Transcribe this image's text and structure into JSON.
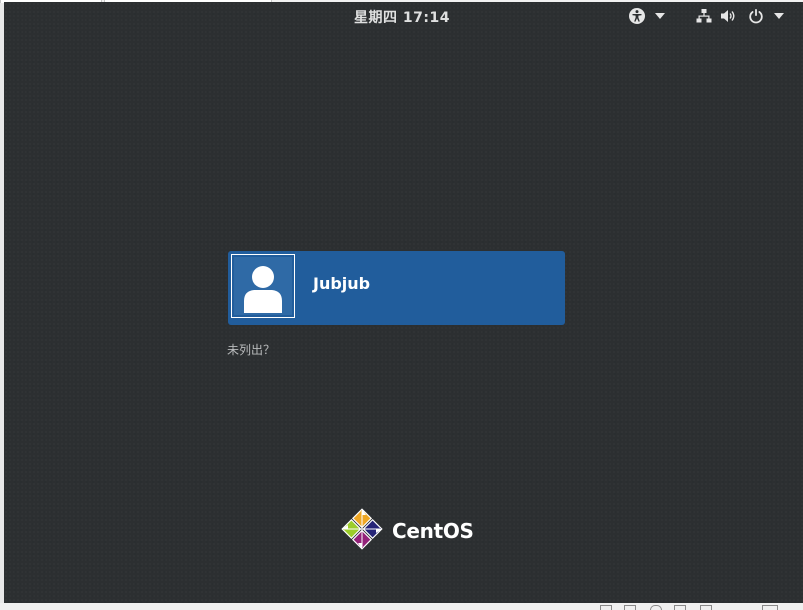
{
  "topbar": {
    "clock": "星期四 17:14",
    "icons": {
      "accessibility": "accessibility-icon",
      "network": "network-wired-icon",
      "volume": "volume-icon",
      "power": "power-icon"
    }
  },
  "login": {
    "users": [
      {
        "name": "Jubjub",
        "avatar": "default-user-avatar-icon"
      }
    ],
    "not_listed_label": "未列出？"
  },
  "brand": {
    "name": "CentOS",
    "logo": "centos-logo"
  },
  "colors": {
    "background": "#2c2f31",
    "user_card": "#215d9c",
    "text_primary": "#ffffff",
    "text_muted": "#b9bbbc"
  }
}
